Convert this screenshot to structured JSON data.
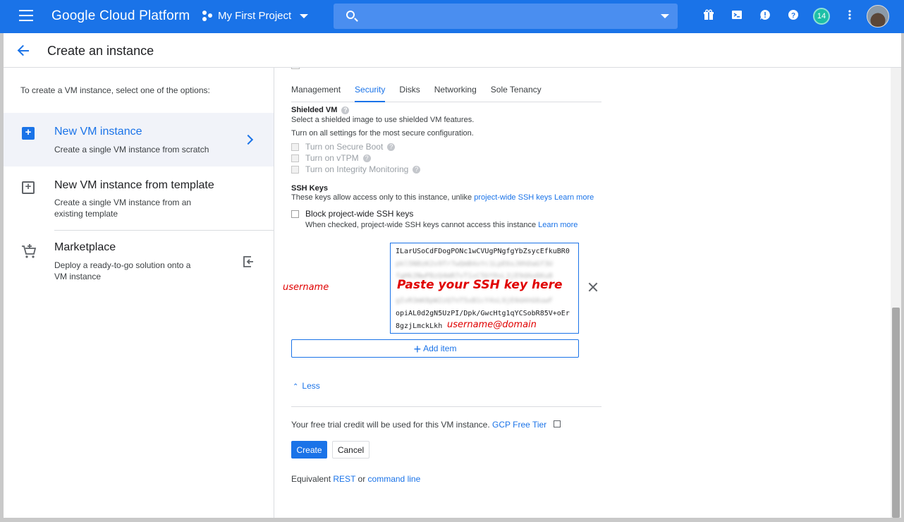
{
  "topbar": {
    "brand": "Google Cloud Platform",
    "project": "My First Project",
    "notifications_count": "14",
    "icons": [
      "menu-icon",
      "gift-icon",
      "cloud-shell-icon",
      "feedback-icon",
      "help-icon",
      "more-vert-icon"
    ]
  },
  "header": {
    "title": "Create an instance"
  },
  "sidebar": {
    "intro": "To create a VM instance, select one of the options:",
    "options": [
      {
        "title": "New VM instance",
        "desc": "Create a single VM instance from scratch"
      },
      {
        "title": "New VM instance from template",
        "desc": "Create a single VM instance from an existing template"
      },
      {
        "title": "Marketplace",
        "desc": "Deploy a ready-to-go solution onto a VM instance"
      }
    ]
  },
  "main": {
    "tabs": [
      "Management",
      "Security",
      "Disks",
      "Networking",
      "Sole Tenancy"
    ],
    "active_tab": "Security",
    "shielded": {
      "title": "Shielded VM",
      "line1": "Select a shielded image to use shielded VM features.",
      "line2": "Turn on all settings for the most secure configuration.",
      "opts": [
        "Turn on Secure Boot",
        "Turn on vTPM",
        "Turn on Integrity Monitoring"
      ]
    },
    "ssh": {
      "title": "SSH Keys",
      "desc": "These keys allow access only to this instance, unlike",
      "desc_link": "project-wide SSH keys",
      "learn_more": "Learn more",
      "block_label": "Block project-wide SSH keys",
      "block_desc": "When checked, project-wide SSH keys cannot access this instance",
      "key_line1": "ILarUSoCdFDogPONc1wCVUgPNgfgYbZsycEfkuBR0",
      "key_line6": "opiAL0d2gN5UzPI/Dpk/GwcHtg1qYCSobR85V+oEr",
      "key_line7": "8gzjLmckLkh",
      "annotation_paste": "Paste your SSH key here",
      "annotation_user": "username",
      "annotation_domain": "username@domain"
    },
    "add_item": "Add item",
    "less": "Less",
    "trial_text": "Your free trial credit will be used for this VM instance.",
    "trial_link": "GCP Free Tier",
    "create": "Create",
    "cancel": "Cancel",
    "equiv_prefix": "Equivalent",
    "equiv_rest": "REST",
    "equiv_or": "or",
    "equiv_cmd": "command line"
  },
  "colors": {
    "brand_blue": "#1a73e8",
    "annotation_red": "#e00000"
  }
}
